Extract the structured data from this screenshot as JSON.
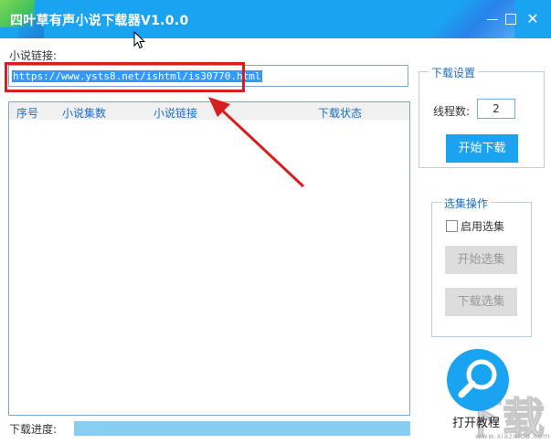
{
  "window": {
    "title": "四叶草有声小说下载器V1.0.0",
    "controls": {
      "minimize_icon": "minimize-icon",
      "maximize_icon": "maximize-icon",
      "close_icon": "close-icon",
      "close_glyph": "✕"
    }
  },
  "main": {
    "url_label": "小说链接:",
    "url_value": "https://www.ysts8.net/ishtml/is30770.html",
    "table": {
      "columns": [
        "序号",
        "小说集数",
        "小说链接",
        "下载状态"
      ],
      "rows": []
    },
    "progress_label": "下载进度:",
    "progress_fraction": 0
  },
  "download_settings": {
    "title": "下载设置",
    "threads_label": "线程数:",
    "threads_value": "2",
    "start_button": "开始下载"
  },
  "selection": {
    "title": "选集操作",
    "enable_label": "启用选集",
    "enable_checked": false,
    "start_select_button": "开始选集",
    "download_select_button": "下载选集"
  },
  "tutorial": {
    "icon": "magnifier-icon",
    "label": "打开教程"
  },
  "watermark": {
    "text": "下载吧",
    "sub": "www.xiazaiba.com"
  },
  "colors": {
    "titlebar": "#1aa3f0",
    "accent_blue": "#1aa3f0",
    "highlight_red": "#d81e1e",
    "disabled_button": "#dddddd",
    "progress_track": "#87cef0"
  }
}
